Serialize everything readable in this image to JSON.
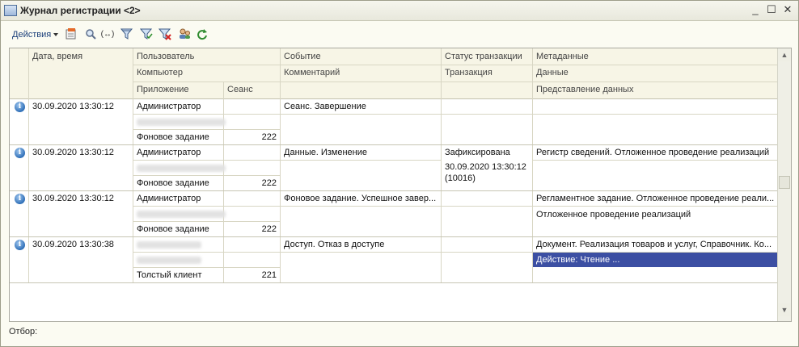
{
  "window": {
    "title": "Журнал регистрации <2>",
    "minimize": "_",
    "maximize": "☐",
    "close": "✕"
  },
  "toolbar": {
    "actions_label": "Действия",
    "icons": [
      "properties-icon",
      "find-icon",
      "navigate-icon",
      "filter-icon",
      "filter-set-icon",
      "filter-clear-icon",
      "users-icon",
      "refresh-icon"
    ],
    "link_glyph": "(↔)"
  },
  "columns": {
    "datetime": "Дата, время",
    "user": "Пользователь",
    "computer": "Компьютер",
    "application": "Приложение",
    "session": "Сеанс",
    "event": "Событие",
    "comment": "Комментарий",
    "tx_status": "Статус транзакции",
    "transaction": "Транзакция",
    "metadata": "Метаданные",
    "data": "Данные",
    "data_repr": "Представление данных"
  },
  "rows": [
    {
      "icon": "i",
      "datetime": "30.09.2020 13:30:12",
      "user": "Администратор",
      "application": "Фоновое задание",
      "session": "222",
      "event": "Сеанс. Завершение",
      "comment": "",
      "tx_status": "",
      "transaction": "",
      "metadata": "",
      "data": "",
      "data_repr": ""
    },
    {
      "icon": "i",
      "datetime": "30.09.2020 13:30:12",
      "user": "Администратор",
      "application": "Фоновое задание",
      "session": "222",
      "event": "Данные. Изменение",
      "comment": "",
      "tx_status": "Зафиксирована",
      "transaction": "30.09.2020 13:30:12 (10016)",
      "metadata": "Регистр сведений. Отложенное проведение реализаций",
      "data": "",
      "data_repr": ""
    },
    {
      "icon": "i",
      "datetime": "30.09.2020 13:30:12",
      "user": "Администратор",
      "application": "Фоновое задание",
      "session": "222",
      "event": "Фоновое задание. Успешное завер...",
      "comment": "",
      "tx_status": "",
      "transaction": "",
      "metadata": "Регламентное задание. Отложенное проведение реали...",
      "data": "Отложенное проведение реализаций",
      "data_repr": ""
    },
    {
      "icon": "i",
      "datetime": "30.09.2020 13:30:38",
      "user": "",
      "application": "Толстый клиент",
      "session": "221",
      "event": "Доступ. Отказ в доступе",
      "comment": "",
      "tx_status": "",
      "transaction": "",
      "metadata": "Документ. Реализация товаров и услуг, Справочник. Ко...",
      "data": "Действие: Чтение ...",
      "data_repr": ""
    }
  ],
  "scroll": {
    "up": "▲",
    "down": "▼"
  },
  "footer": {
    "filter_label": "Отбор:"
  }
}
